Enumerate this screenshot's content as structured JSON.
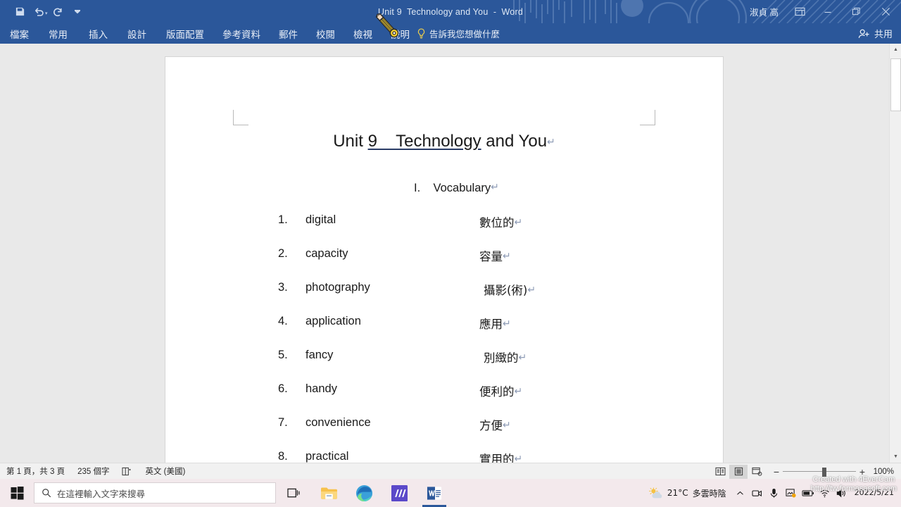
{
  "titlebar": {
    "document_title": "Unit 9  Technology and You  -  Word",
    "user_name": "淑貞 高",
    "quick_access": [
      {
        "name": "save",
        "icon": "floppy-disk-icon"
      },
      {
        "name": "undo",
        "icon": "undo-arrow-icon"
      },
      {
        "name": "redo",
        "icon": "redo-arrow-icon"
      },
      {
        "name": "customize",
        "icon": "chevron-down-icon"
      }
    ],
    "window_buttons": [
      {
        "name": "ribbon-display-options",
        "icon": "ribbon-options-icon"
      },
      {
        "name": "minimize",
        "icon": "minimize-icon",
        "glyph": "—"
      },
      {
        "name": "restore",
        "icon": "restore-icon"
      },
      {
        "name": "close",
        "icon": "close-icon",
        "glyph": "✕"
      }
    ]
  },
  "ribbon": {
    "tabs": [
      {
        "label": "檔案",
        "name": "tab-file"
      },
      {
        "label": "常用",
        "name": "tab-home"
      },
      {
        "label": "插入",
        "name": "tab-insert"
      },
      {
        "label": "設計",
        "name": "tab-design"
      },
      {
        "label": "版面配置",
        "name": "tab-layout"
      },
      {
        "label": "參考資料",
        "name": "tab-references"
      },
      {
        "label": "郵件",
        "name": "tab-mailings"
      },
      {
        "label": "校閱",
        "name": "tab-review"
      },
      {
        "label": "檢視",
        "name": "tab-view"
      },
      {
        "label": "說明",
        "name": "tab-help"
      }
    ],
    "tell_me": "告訴我您想做什麼",
    "share_label": "共用"
  },
  "document": {
    "title_part1": "Unit ",
    "title_underlined": "9    Technology",
    "title_part2": " and You",
    "pilcrow": "↵",
    "section_heading": "I.    Vocabulary",
    "vocabulary": [
      {
        "num": "1.",
        "term": "digital",
        "zh": "數位的"
      },
      {
        "num": "2.",
        "term": "capacity",
        "zh": "容量"
      },
      {
        "num": "3.",
        "term": "photography",
        "zh": "攝影(術)"
      },
      {
        "num": "4.",
        "term": "application",
        "zh": "應用"
      },
      {
        "num": "5.",
        "term": "fancy",
        "zh": "別緻的"
      },
      {
        "num": "6.",
        "term": "handy",
        "zh": "便利的"
      },
      {
        "num": "7.",
        "term": "convenience",
        "zh": "方便"
      },
      {
        "num": "8.",
        "term": "practical",
        "zh": "實用的"
      }
    ]
  },
  "statusbar": {
    "page_info": "第 1 頁，共 3 頁",
    "word_count": "235 個字",
    "proofing_name": "proofing-icon",
    "language": "英文 (美國)",
    "views": [
      {
        "name": "read-mode-view",
        "icon": "read-mode-icon",
        "active": false
      },
      {
        "name": "print-layout-view",
        "icon": "print-layout-icon",
        "active": true
      },
      {
        "name": "web-layout-view",
        "icon": "web-layout-icon",
        "active": false
      }
    ],
    "zoom_out": "−",
    "zoom_in": "+",
    "zoom_level": "100%"
  },
  "taskbar": {
    "start_name": "windows-start-icon",
    "search_placeholder": "在這裡輸入文字來搜尋",
    "search_value": "",
    "apps": [
      {
        "name": "task-view-button",
        "icon": "task-view-icon"
      },
      {
        "name": "file-explorer",
        "icon": "folder-icon"
      },
      {
        "name": "microsoft-edge",
        "icon": "edge-icon"
      },
      {
        "name": "app-purple-m",
        "icon": "letter-m-icon"
      },
      {
        "name": "microsoft-word",
        "icon": "word-icon",
        "active": true
      }
    ],
    "weather": {
      "temperature": "21°C",
      "condition": "多雲時陰",
      "icon": "partly-cloudy-icon"
    },
    "tray_icons": [
      {
        "name": "show-hidden-icons",
        "icon": "chevron-up-icon"
      },
      {
        "name": "camera-tray-icon",
        "icon": "camera-icon"
      },
      {
        "name": "microphone-tray-icon",
        "icon": "microphone-icon"
      },
      {
        "name": "onedrive-tray-icon",
        "icon": "onedrive-icon"
      },
      {
        "name": "battery-tray-icon",
        "icon": "battery-icon"
      },
      {
        "name": "network-tray-icon",
        "icon": "wifi-icon"
      },
      {
        "name": "volume-tray-icon",
        "icon": "speaker-icon"
      }
    ],
    "clock_date": "2022/5/21"
  },
  "overlay": {
    "watermark_line1": "Created with 4EverCam",
    "watermark_line2": "http://tw.formosasoft.com",
    "cursor_name": "pencil-cursor-icon"
  },
  "colors": {
    "word_blue": "#2b579a",
    "doc_bg": "#e9e9e9",
    "page_white": "#ffffff",
    "taskbar": "#f3e9ec",
    "statusbar": "#f1f1f1"
  }
}
